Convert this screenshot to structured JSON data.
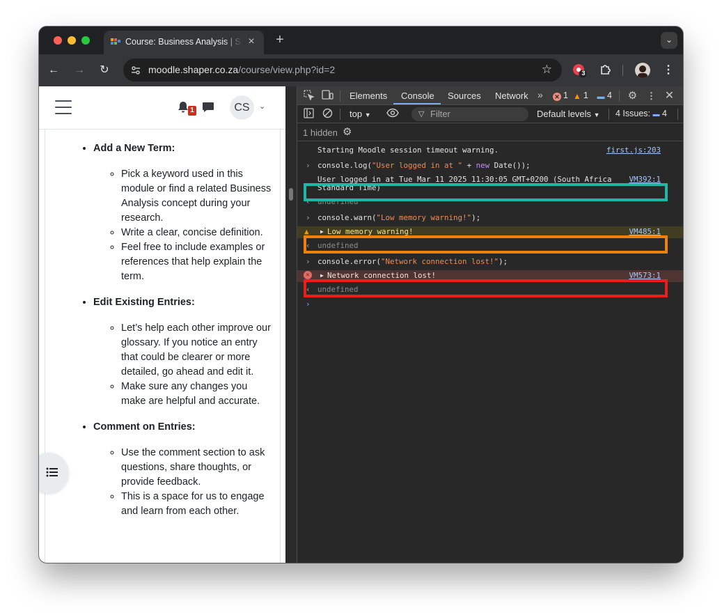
{
  "browser": {
    "tab_title": "Course: Business Analysis | Shaper",
    "url_host": "moodle.shaper.co.za",
    "url_path": "/course/view.php?id=2",
    "extension_badge": "3"
  },
  "moodle": {
    "notification_count": "1",
    "user_initials": "CS",
    "sections": [
      {
        "title": "Add a New Term:",
        "items": [
          "Pick a keyword used in this module or find a related Business Analysis concept during your research.",
          "Write a clear, concise definition.",
          "Feel free to include examples or references that help explain the term."
        ]
      },
      {
        "title": "Edit Existing Entries:",
        "items": [
          "Let’s help each other improve our glossary. If you notice an entry that could be clearer or more detailed, go ahead and edit it.",
          "Make sure any changes you make are helpful and accurate."
        ]
      },
      {
        "title": "Comment on Entries:",
        "items": [
          "Use the comment section to ask questions, share thoughts, or provide feedback.",
          "This is a space for us to engage and learn from each other."
        ]
      }
    ]
  },
  "devtools": {
    "tabs": [
      "Elements",
      "Console",
      "Sources",
      "Network"
    ],
    "active_tab": "Console",
    "error_count": "1",
    "warning_count": "1",
    "info_count": "4",
    "context": "top",
    "filter_placeholder": "Filter",
    "levels_label": "Default levels",
    "issues_label": "4 Issues:",
    "issues_count": "4",
    "hidden_label": "1 hidden",
    "console": {
      "line1_text": "Starting Moodle session timeout warning.",
      "line1_src": "first.js:203",
      "cmd1_obj": "console.",
      "cmd1_fn": "log",
      "cmd1_str": "\"User logged in at \"",
      "cmd1_kw": "new",
      "cmd1_tail": " Date());",
      "out1_text": "User logged in at Tue Mar 11 2025 11:30:05 GMT+0200 (South Africa\nStandard Time)",
      "out1_src": "VM392:1",
      "undefined": "undefined",
      "cmd2_obj": "console.",
      "cmd2_fn": "warn",
      "cmd2_str": "\"Low memory warning!\"",
      "warn_text": "Low memory warning!",
      "warn_src": "VM485:1",
      "cmd3_obj": "console.",
      "cmd3_fn": "error",
      "cmd3_str": "\"Network connection lost!\"",
      "err_text": "Network connection lost!",
      "err_src": "VM573:1"
    },
    "highlight_colors": {
      "log": "#1fb8a7",
      "warn": "#f0800c",
      "error": "#ee1c1c"
    }
  }
}
